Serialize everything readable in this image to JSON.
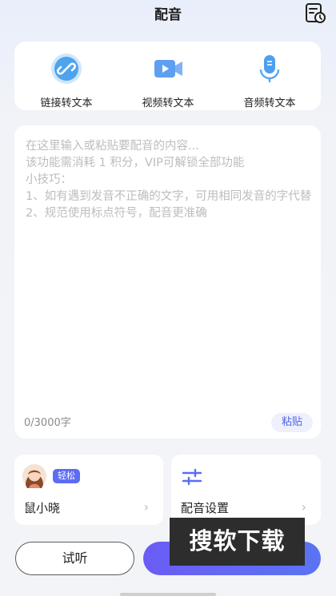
{
  "header": {
    "title": "配音"
  },
  "convert": {
    "items": [
      {
        "label": "链接转文本",
        "icon": "link-icon"
      },
      {
        "label": "视频转文本",
        "icon": "video-icon"
      },
      {
        "label": "音频转文本",
        "icon": "microphone-icon"
      }
    ]
  },
  "editor": {
    "placeholder_lines": [
      "在这里输入或粘贴要配音的内容...",
      "该功能需消耗 1 积分，VIP可解锁全部功能",
      "小技巧：",
      "1、如有遇到发音不正确的文字，可用相同发音的字代替",
      "2、规范使用标点符号，配音更准确"
    ],
    "counter": "0/3000字",
    "paste_label": "粘贴"
  },
  "voice": {
    "badge": "轻松",
    "name": "鼠小晓"
  },
  "settings": {
    "label": "配音设置"
  },
  "actions": {
    "listen_label": "试听"
  },
  "watermark": {
    "text": "搜软下载"
  },
  "colors": {
    "accent": "#5d6df2",
    "primary_button": "#6b5cf5"
  }
}
